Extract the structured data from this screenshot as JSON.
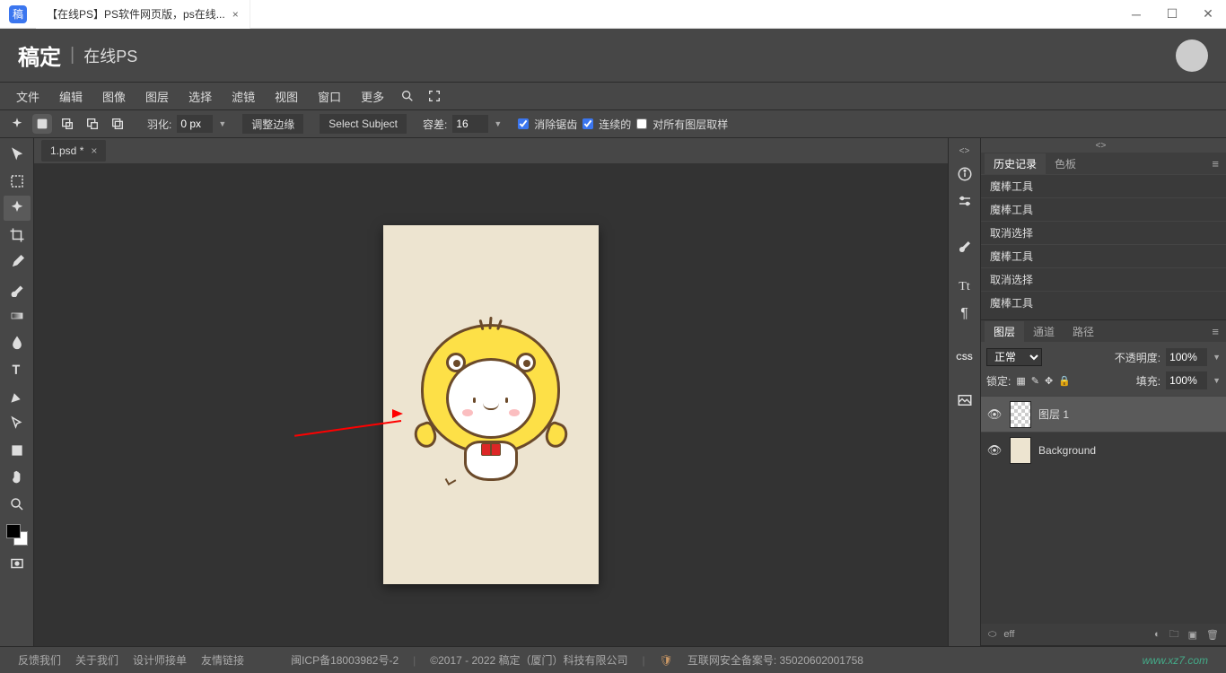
{
  "titlebar": {
    "logo_text": "稿",
    "tab_title": "【在线PS】PS软件网页版，ps在线..."
  },
  "header": {
    "brand": "稿定",
    "product": "在线PS"
  },
  "menu": {
    "file": "文件",
    "edit": "编辑",
    "image": "图像",
    "layer": "图层",
    "select": "选择",
    "filter": "滤镜",
    "view": "视图",
    "window": "窗口",
    "more": "更多"
  },
  "tooloptions": {
    "feather_label": "羽化:",
    "feather_value": "0 px",
    "refine_edge": "调整边缘",
    "select_subject": "Select Subject",
    "tolerance_label": "容差:",
    "tolerance_value": "16",
    "antialias": "消除锯齿",
    "contiguous": "连续的",
    "sample_all": "对所有图层取样"
  },
  "doctab": {
    "name": "1.psd *"
  },
  "panels": {
    "history_tab": "历史记录",
    "swatches_tab": "色板",
    "history_items": [
      "魔棒工具",
      "魔棒工具",
      "取消选择",
      "魔棒工具",
      "取消选择",
      "魔棒工具"
    ],
    "layers_tab": "图层",
    "channels_tab": "通道",
    "paths_tab": "路径",
    "blend_mode": "正常",
    "opacity_label": "不透明度:",
    "opacity_value": "100%",
    "lock_label": "锁定:",
    "fill_label": "填充:",
    "fill_value": "100%",
    "layers": [
      {
        "name": "图层 1",
        "visible": true,
        "selected": true
      },
      {
        "name": "Background",
        "visible": true,
        "selected": false
      }
    ],
    "footer_eff": "eff"
  },
  "sidepanel_icons": {
    "more": "<>",
    "css": "CSS",
    "tt": "Tt",
    "para": "¶"
  },
  "statusbar": {
    "feedback": "反馈我们",
    "about": "关于我们",
    "designer": "设计师接单",
    "links": "友情链接",
    "icp": "闽ICP备18003982号-2",
    "copyright": "©2017 - 2022 稿定（厦门）科技有限公司",
    "security": "互联网安全备案号: 35020602001758",
    "watermark": "www.xz7.com"
  }
}
